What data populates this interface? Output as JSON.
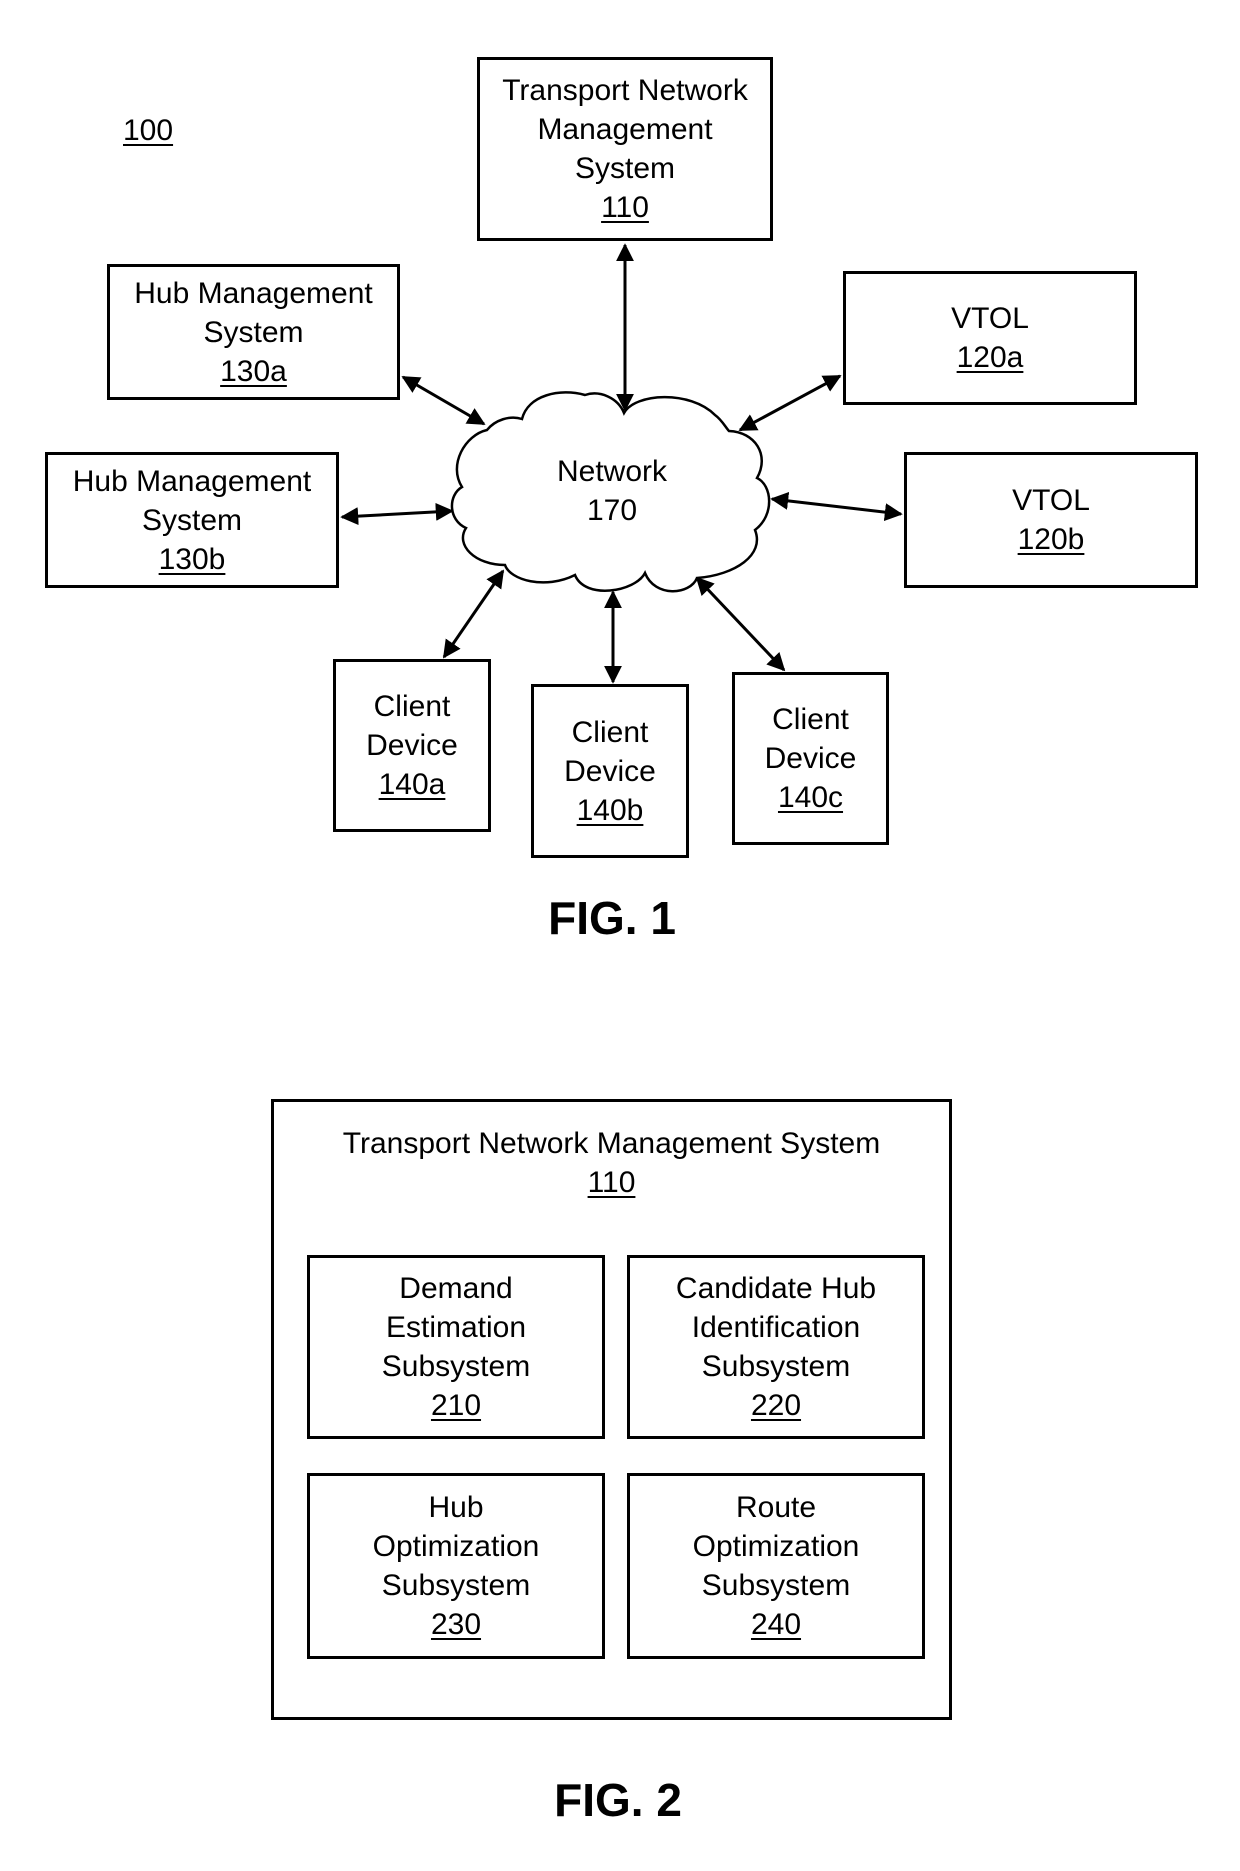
{
  "fig1": {
    "system_ref": "100",
    "caption": "FIG. 1",
    "tnms": {
      "lines": [
        "Transport Network",
        "Management",
        "System"
      ],
      "ref": "110"
    },
    "vtol_a": {
      "lines": [
        "VTOL"
      ],
      "ref": "120a"
    },
    "vtol_b": {
      "lines": [
        "VTOL"
      ],
      "ref": "120b"
    },
    "hub_a": {
      "lines": [
        "Hub Management",
        "System"
      ],
      "ref": "130a"
    },
    "hub_b": {
      "lines": [
        "Hub Management",
        "System"
      ],
      "ref": "130b"
    },
    "client_a": {
      "lines": [
        "Client",
        "Device"
      ],
      "ref": "140a"
    },
    "client_b": {
      "lines": [
        "Client",
        "Device"
      ],
      "ref": "140b"
    },
    "client_c": {
      "lines": [
        "Client",
        "Device"
      ],
      "ref": "140c"
    },
    "network": {
      "lines": [
        "Network"
      ],
      "ref": "170"
    },
    "connections": [
      {
        "from": "network",
        "to": "tnms",
        "type": "bidirectional"
      },
      {
        "from": "network",
        "to": "vtol_a",
        "type": "bidirectional"
      },
      {
        "from": "network",
        "to": "vtol_b",
        "type": "bidirectional"
      },
      {
        "from": "network",
        "to": "hub_a",
        "type": "bidirectional"
      },
      {
        "from": "network",
        "to": "hub_b",
        "type": "bidirectional"
      },
      {
        "from": "network",
        "to": "client_a",
        "type": "bidirectional"
      },
      {
        "from": "network",
        "to": "client_b",
        "type": "bidirectional"
      },
      {
        "from": "network",
        "to": "client_c",
        "type": "bidirectional"
      }
    ]
  },
  "fig2": {
    "caption": "FIG. 2",
    "container": {
      "title": "Transport Network Management System",
      "ref": "110"
    },
    "subsystems": [
      {
        "lines": [
          "Demand",
          "Estimation",
          "Subsystem"
        ],
        "ref": "210"
      },
      {
        "lines": [
          "Candidate Hub",
          "Identification",
          "Subsystem"
        ],
        "ref": "220"
      },
      {
        "lines": [
          "Hub",
          "Optimization",
          "Subsystem"
        ],
        "ref": "230"
      },
      {
        "lines": [
          "Route",
          "Optimization",
          "Subsystem"
        ],
        "ref": "240"
      }
    ]
  }
}
